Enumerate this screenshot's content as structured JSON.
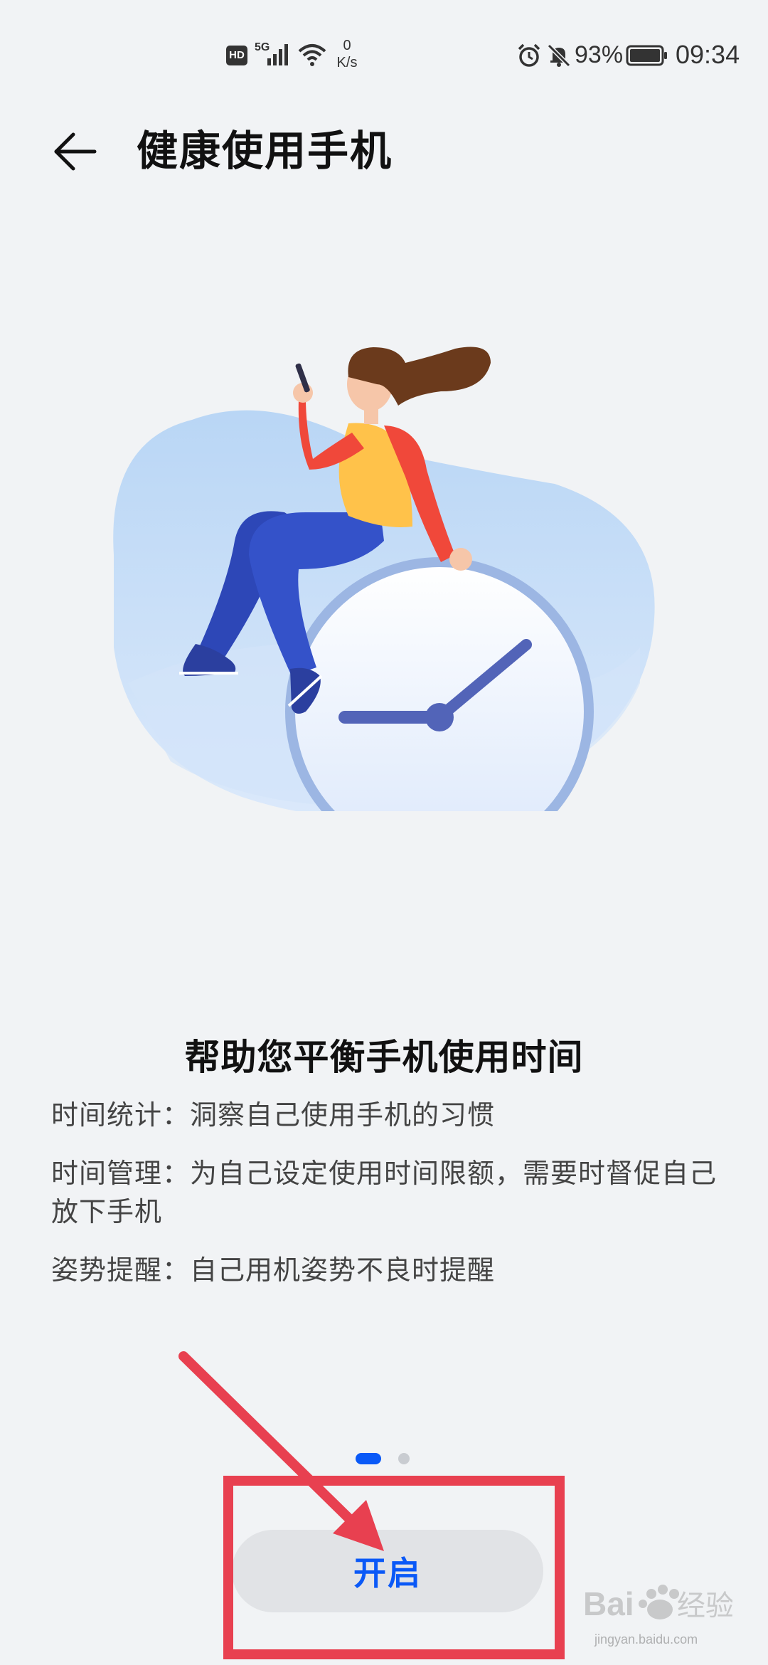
{
  "status_bar": {
    "hd": "HD",
    "network": "5G",
    "speed_value": "0",
    "speed_unit": "K/s",
    "battery": "93%",
    "time": "09:34",
    "icons": [
      "signal-icon",
      "wifi-icon",
      "alarm-icon",
      "mute-icon",
      "battery-icon"
    ]
  },
  "header": {
    "title": "健康使用手机"
  },
  "content": {
    "headline": "帮助您平衡手机使用时间",
    "features": [
      "时间统计：洞察自己使用手机的习惯",
      "时间管理：为自己设定使用时间限额，需要时督促自己放下手机",
      "姿势提醒：自己用机姿势不良时提醒"
    ]
  },
  "pager": {
    "current": 1,
    "total": 2
  },
  "button": {
    "label": "开启"
  },
  "colors": {
    "accent": "#0a59f7",
    "annotation": "#e84050",
    "background": "#f1f3f5"
  }
}
